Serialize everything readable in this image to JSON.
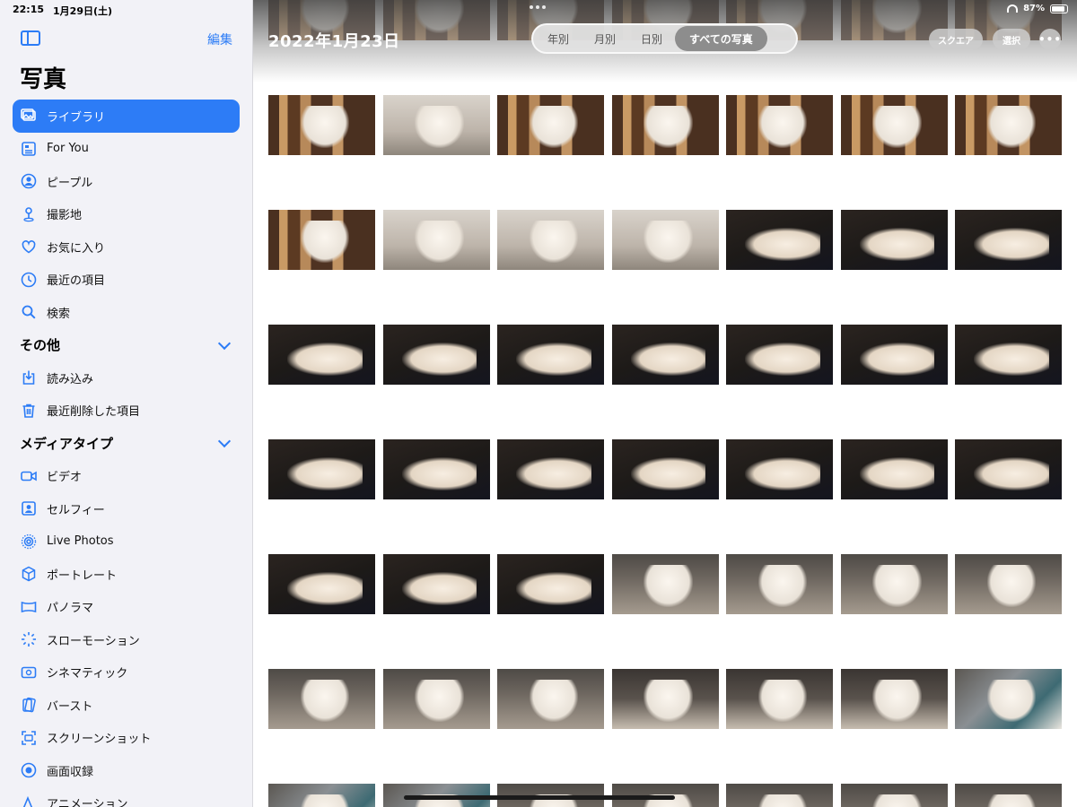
{
  "status": {
    "time": "22:15",
    "date": "1月29日(土)",
    "battery_text": "87%",
    "battery_level": 0.87
  },
  "sidebar": {
    "edit_label": "編集",
    "title": "写真",
    "items": [
      {
        "label": "ライブラリ",
        "icon": "photo-library-icon",
        "active": true
      },
      {
        "label": "For You",
        "icon": "for-you-icon"
      },
      {
        "label": "ピープル",
        "icon": "person-circle-icon"
      },
      {
        "label": "撮影地",
        "icon": "map-pin-icon"
      },
      {
        "label": "お気に入り",
        "icon": "heart-icon"
      },
      {
        "label": "最近の項目",
        "icon": "clock-icon"
      },
      {
        "label": "検索",
        "icon": "search-icon"
      }
    ],
    "sections": [
      {
        "title": "その他",
        "items": [
          {
            "label": "読み込み",
            "icon": "import-icon"
          },
          {
            "label": "最近削除した項目",
            "icon": "trash-icon"
          }
        ]
      },
      {
        "title": "メディアタイプ",
        "items": [
          {
            "label": "ビデオ",
            "icon": "video-icon"
          },
          {
            "label": "セルフィー",
            "icon": "selfie-icon"
          },
          {
            "label": "Live Photos",
            "icon": "live-photo-icon"
          },
          {
            "label": "ポートレート",
            "icon": "cube-icon"
          },
          {
            "label": "パノラマ",
            "icon": "panorama-icon"
          },
          {
            "label": "スローモーション",
            "icon": "slowmo-icon"
          },
          {
            "label": "シネマティック",
            "icon": "cinematic-icon"
          },
          {
            "label": "バースト",
            "icon": "burst-icon"
          },
          {
            "label": "スクリーンショット",
            "icon": "screenshot-icon"
          },
          {
            "label": "画面収録",
            "icon": "screen-record-icon"
          },
          {
            "label": "アニメーション",
            "icon": "animation-icon"
          }
        ]
      }
    ]
  },
  "main": {
    "date_title": "2022年1月23日",
    "segments": [
      {
        "label": "年別"
      },
      {
        "label": "月別"
      },
      {
        "label": "日別"
      },
      {
        "label": "すべての写真",
        "active": true
      }
    ],
    "square_label": "スクエア",
    "select_label": "選択",
    "more_label": "•••",
    "rows": [
      [
        "t-wood",
        "t-wood",
        "t-wood",
        "t-wood",
        "t-wood",
        "t-wood",
        "t-wood"
      ],
      [
        "t-wood",
        "t-grey",
        "t-wood",
        "t-wood",
        "t-wood",
        "t-wood",
        "t-wood"
      ],
      [
        "t-wood",
        "t-grey",
        "t-grey",
        "t-grey",
        "t-dark lying",
        "t-dark lying",
        "t-dark lying"
      ],
      [
        "t-dark lying",
        "t-dark lying",
        "t-dark lying",
        "t-dark lying",
        "t-dark lying",
        "t-dark lying",
        "t-dark lying"
      ],
      [
        "t-dark lying",
        "t-dark lying",
        "t-dark lying",
        "t-dark lying",
        "t-dark lying",
        "t-dark lying",
        "t-dark lying"
      ],
      [
        "t-dark lying",
        "t-dark lying",
        "t-dark lying",
        "t-floor",
        "t-floor",
        "t-floor",
        "t-floor"
      ],
      [
        "t-floor",
        "t-floor",
        "t-floor",
        "t-shoes",
        "t-shoes",
        "t-shoes",
        "t-cloth"
      ],
      [
        "t-cloth",
        "t-cloth",
        "t-floor",
        "t-floor",
        "t-floor",
        "t-floor",
        "t-floor"
      ]
    ]
  }
}
